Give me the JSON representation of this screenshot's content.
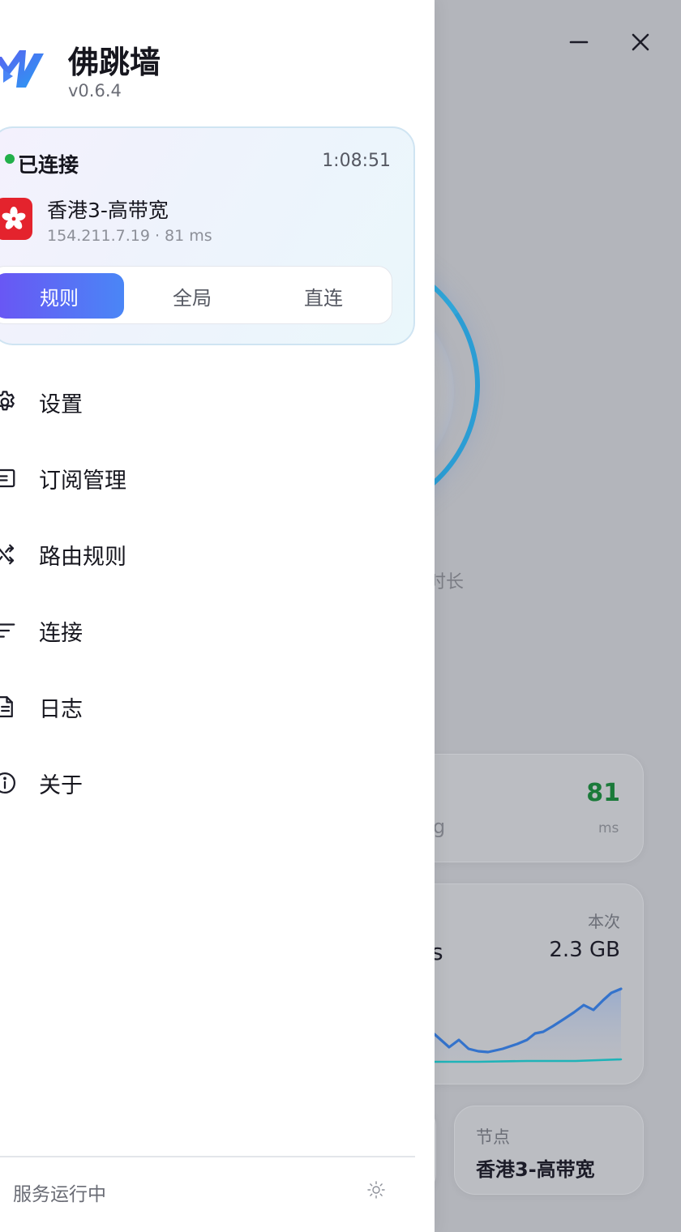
{
  "window": {
    "minimize_icon": "minimize-icon",
    "close_icon": "close-icon"
  },
  "drawer": {
    "logo_icon": "app-logo-icon",
    "app_name": "佛跳墙",
    "version": "v0.6.4",
    "status_card": {
      "status": "已连接",
      "elapsed": "1:08:51",
      "status_color": "#22b04a",
      "node_flag_icon": "hong-kong-flag-icon",
      "node_name": "香港3-高带宽",
      "node_meta": "154.211.7.19 · 81 ms",
      "modes": [
        "规则",
        "全局",
        "直连"
      ],
      "active_mode": "规则",
      "accent_gradient": [
        "#6a55f4",
        "#4a86f6"
      ]
    },
    "nav": [
      {
        "icon": "gear-icon",
        "label": "设置"
      },
      {
        "icon": "subscription-icon",
        "label": "订阅管理"
      },
      {
        "icon": "route-shuffle-icon",
        "label": "路由规则"
      },
      {
        "icon": "connections-list-icon",
        "label": "连接"
      },
      {
        "icon": "log-document-icon",
        "label": "日志"
      },
      {
        "icon": "info-icon",
        "label": "关于"
      }
    ],
    "footer": {
      "status": "服务运行中",
      "theme_icon": "sun-icon"
    }
  },
  "background": {
    "duration_label_fragment": "时长",
    "latency": {
      "value": "81",
      "unit": "ms",
      "label_fragment": "g"
    },
    "traffic": {
      "speed_fragment": "s",
      "session_label": "本次",
      "session_value": "2.3 GB"
    },
    "node": {
      "label": "节点",
      "value": "香港3-高带宽"
    }
  }
}
